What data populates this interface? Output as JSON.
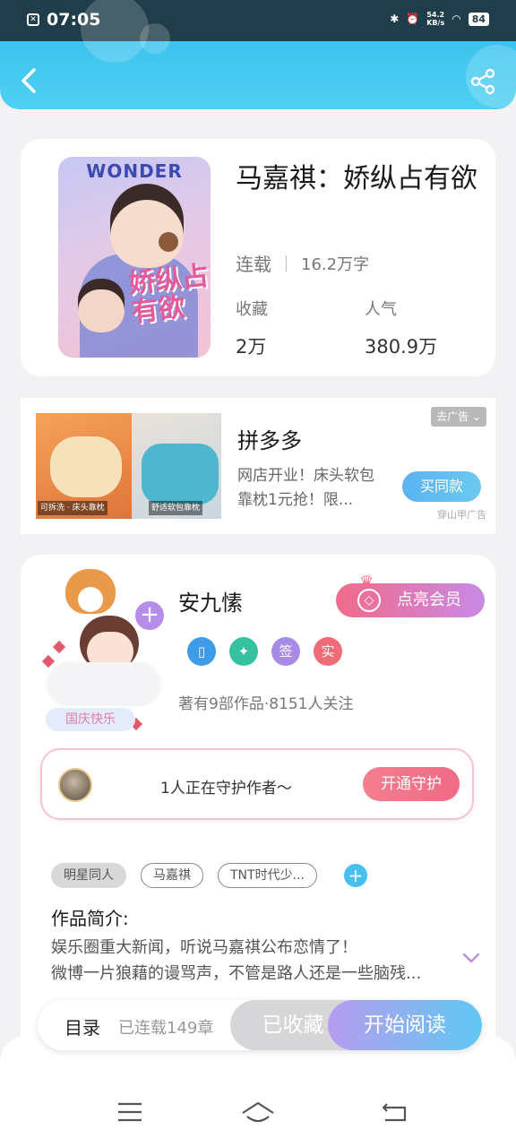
{
  "status_bar": {
    "time": "07:05",
    "net_speed_top": "54.2",
    "net_speed_unit": "KB/s",
    "battery": "84"
  },
  "book": {
    "title": "马嘉祺：娇纵占有欲",
    "status": "连载",
    "words": "16.2万字",
    "fav_label": "收藏",
    "fav_value": "2万",
    "pop_label": "人气",
    "pop_value": "380.9万",
    "cover_top_text": "WONDER",
    "cover_text": "娇纵占有欲"
  },
  "ad": {
    "title": "拼多多",
    "desc": "网店开业！床头软包靠枕1元抢！限...",
    "close_label": "去广告",
    "cta": "买同款",
    "source": "穿山甲广告",
    "img_caption_left": "可拆洗 · 床头靠枕",
    "img_caption_right": "舒适软包靠枕"
  },
  "author": {
    "name": "安九愫",
    "vip_label": "点亮会员",
    "badges": [
      {
        "icon": "phone-icon",
        "text": "▯",
        "color": "#3d9be9"
      },
      {
        "icon": "handshake-icon",
        "text": "✦",
        "color": "#36c2a0"
      },
      {
        "icon": "sign-icon",
        "text": "签",
        "color": "#a78be6"
      },
      {
        "icon": "verified-icon",
        "text": "实",
        "color": "#ef6b78"
      }
    ],
    "stats": "著有9部作品·8151人关注",
    "holiday_badge": "国庆快乐"
  },
  "guard": {
    "text": "1人正在守护作者～",
    "button": "开通守护"
  },
  "tags": [
    "明星同人",
    "马嘉祺",
    "TNT时代少..."
  ],
  "intro": {
    "title": "作品简介:",
    "line1": "娱乐圈重大新闻，听说马嘉祺公布恋情了！",
    "line2": "微博一片狼藉的谩骂声，不管是路人还是一些脑残..."
  },
  "bottom_bar": {
    "toc_label": "目录",
    "toc_status": "已连载149章",
    "collected": "已收藏",
    "start_read": "开始阅读"
  }
}
